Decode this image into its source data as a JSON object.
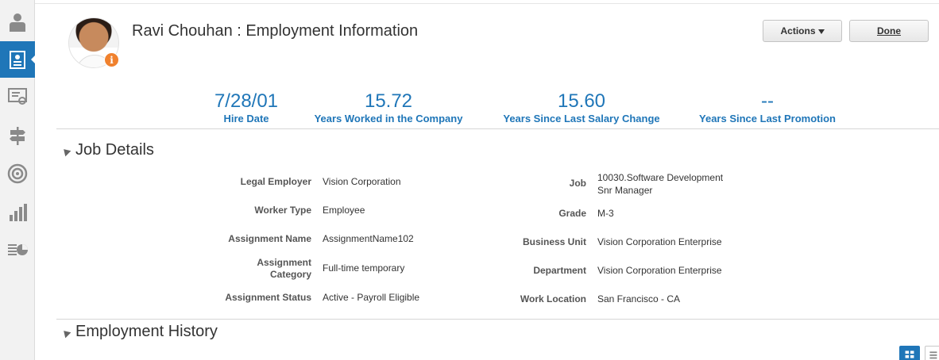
{
  "nav": {
    "items": [
      {
        "icon": "person-icon"
      },
      {
        "icon": "employment-info-icon",
        "active": true
      },
      {
        "icon": "presentation-board-icon"
      },
      {
        "icon": "signpost-icon"
      },
      {
        "icon": "target-icon"
      },
      {
        "icon": "bar-chart-icon"
      },
      {
        "icon": "report-pie-icon"
      }
    ],
    "accent": "#1f76b8"
  },
  "header": {
    "title": "Ravi Chouhan : Employment Information",
    "info_badge": "i",
    "actions_label": "Actions",
    "done_label": "Done"
  },
  "metrics": [
    {
      "value": "7/28/01",
      "label": "Hire Date"
    },
    {
      "value": "15.72",
      "label": "Years Worked in the Company"
    },
    {
      "value": "15.60",
      "label": "Years Since Last Salary Change"
    },
    {
      "value": "--",
      "label": "Years Since Last Promotion"
    }
  ],
  "job_details": {
    "heading": "Job Details",
    "left": [
      {
        "label": "Legal Employer",
        "value": "Vision Corporation"
      },
      {
        "label": "Worker Type",
        "value": "Employee"
      },
      {
        "label": "Assignment Name",
        "value": "AssignmentName102"
      },
      {
        "label": "Assignment Category",
        "value": "Full-time temporary"
      },
      {
        "label": "Assignment Status",
        "value": "Active - Payroll Eligible"
      }
    ],
    "right": [
      {
        "label": "Job",
        "value": "10030.Software Development Snr Manager"
      },
      {
        "label": "Grade",
        "value": "M-3"
      },
      {
        "label": "Business Unit",
        "value": "Vision Corporation Enterprise"
      },
      {
        "label": "Department",
        "value": "Vision Corporation Enterprise"
      },
      {
        "label": "Work Location",
        "value": "San Francisco - CA"
      }
    ]
  },
  "employment_history": {
    "heading": "Employment History"
  }
}
